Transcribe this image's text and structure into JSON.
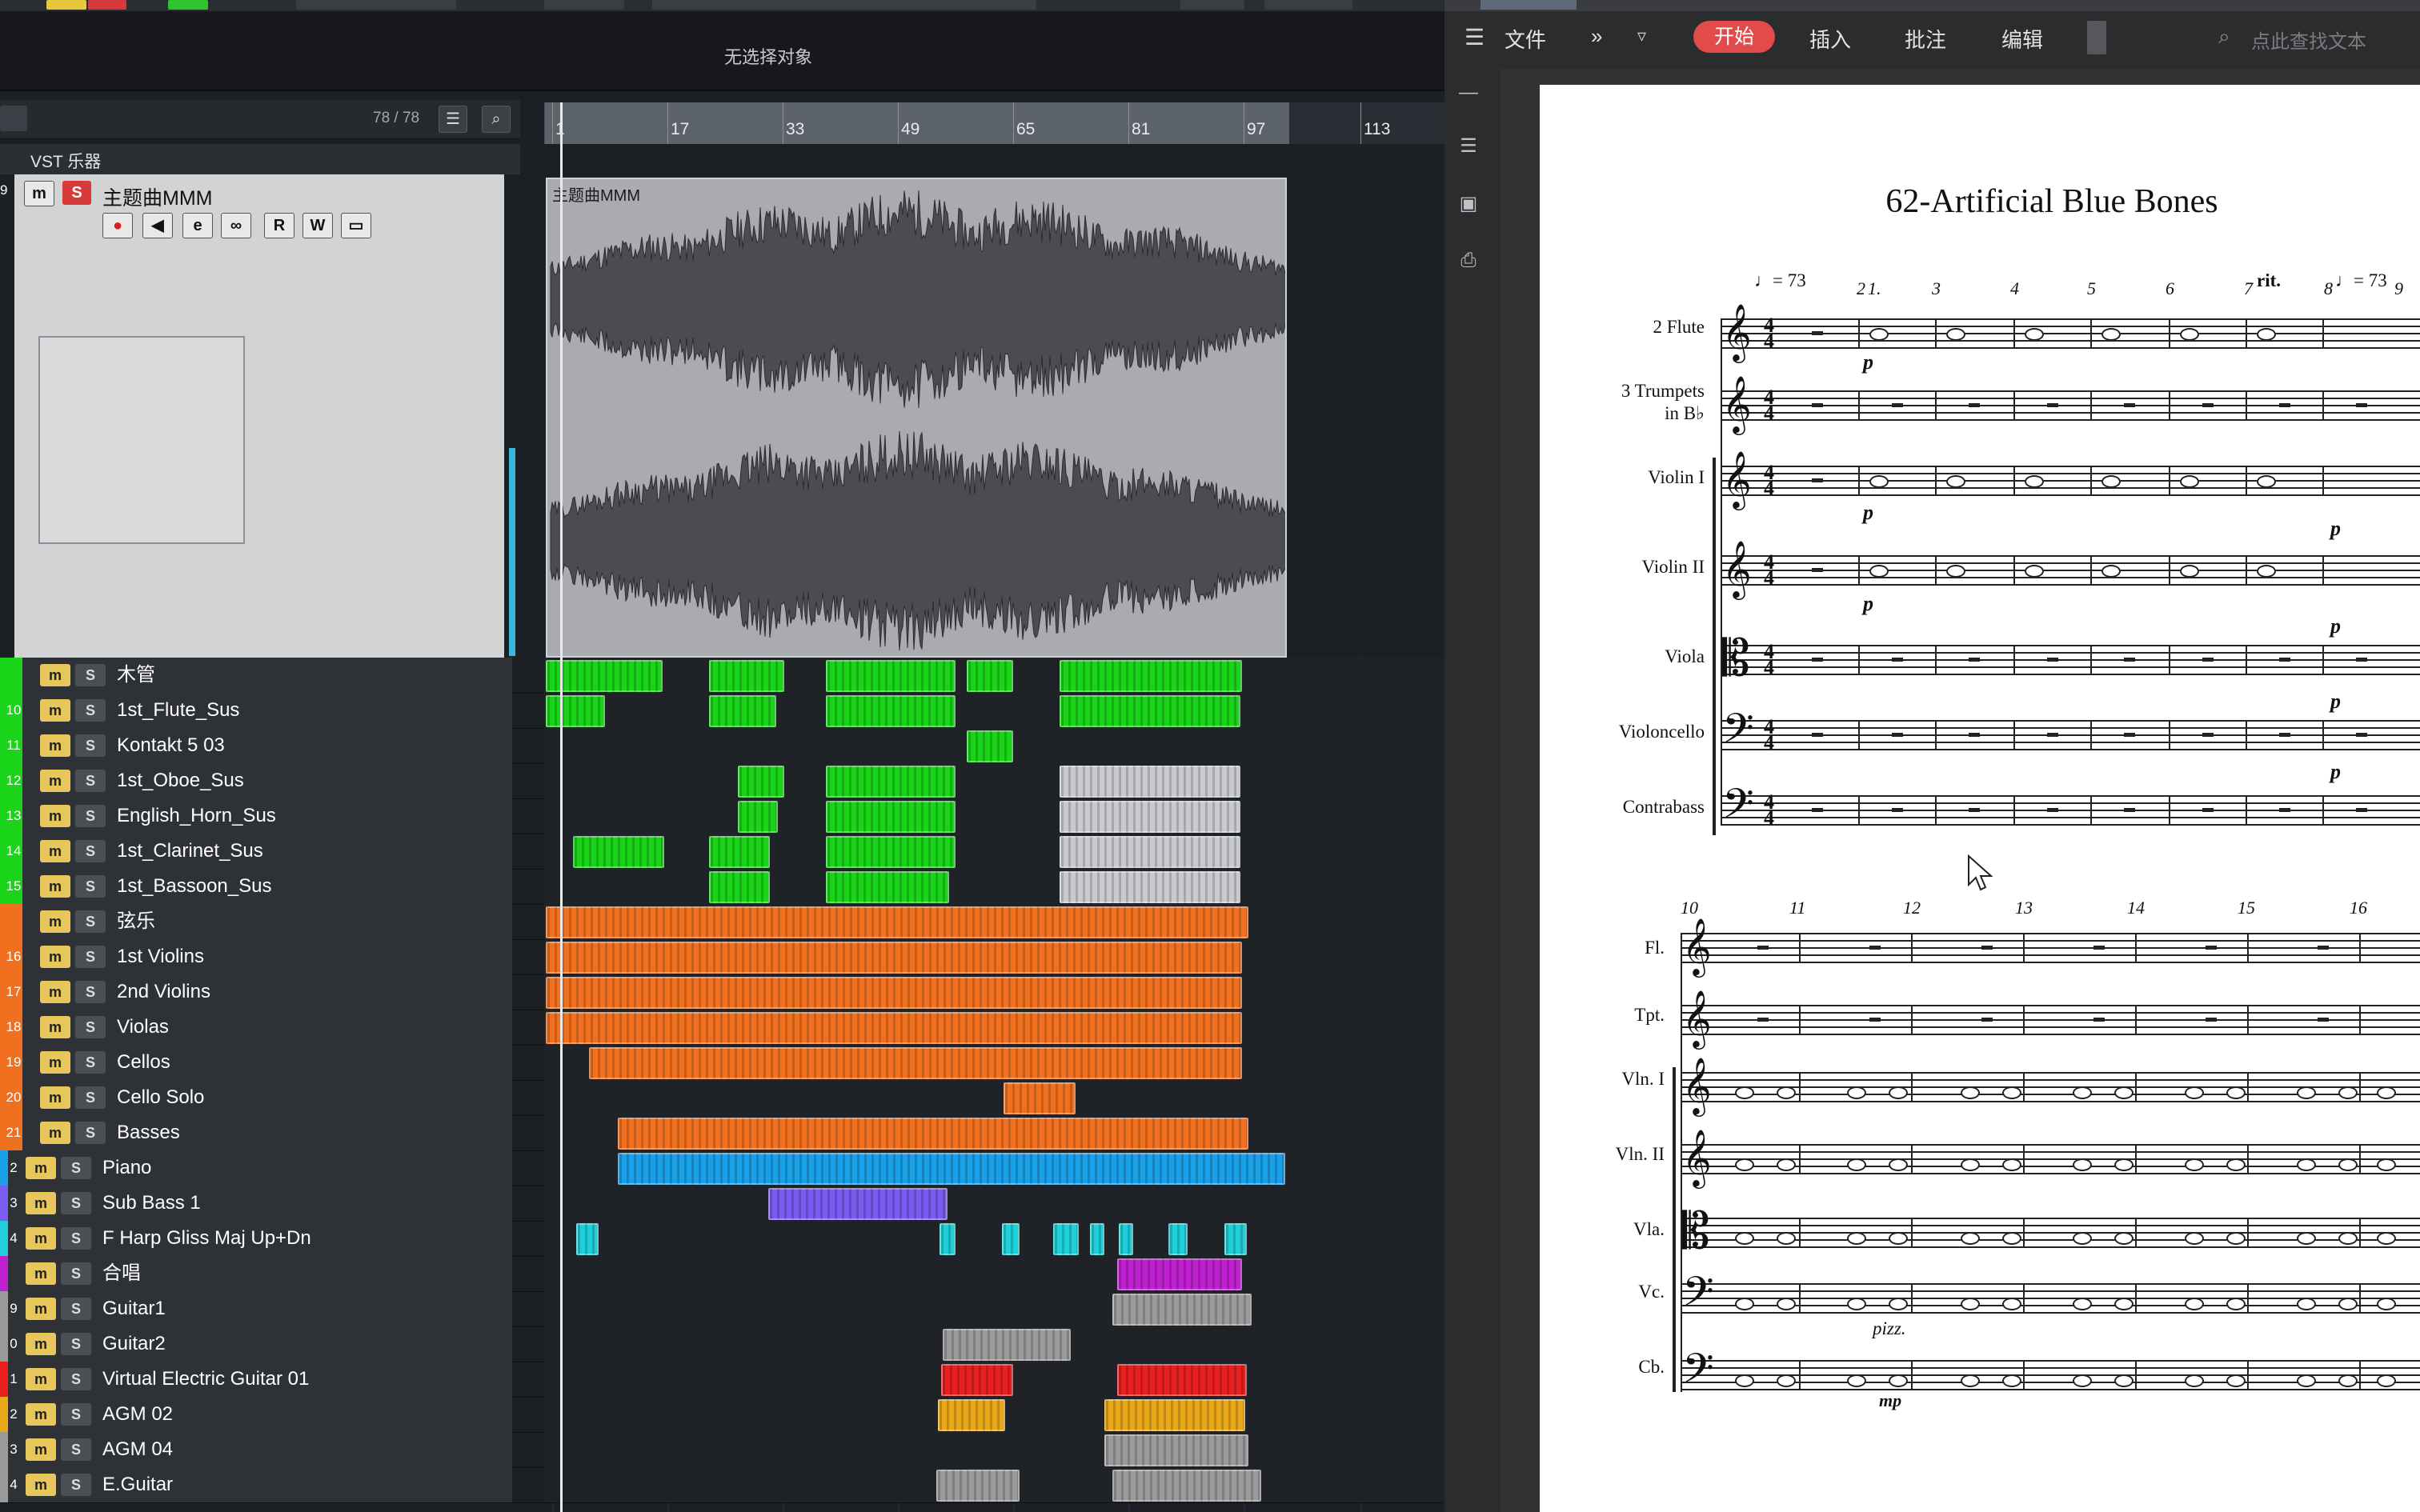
{
  "daw": {
    "selection_status": "无选择对象",
    "track_count": "78 / 78",
    "ruler_bars": [
      "1",
      "17",
      "33",
      "49",
      "65",
      "81",
      "97",
      "113"
    ],
    "folder_label": "VST 乐器",
    "main_track": {
      "number": "9",
      "name": "主题曲MMM",
      "event_label": "主题曲MMM",
      "buttons": [
        "m",
        "S",
        "●",
        "◀",
        "e",
        "∞",
        "R",
        "W",
        "▭"
      ]
    },
    "tracks": [
      {
        "num": "",
        "name": "木管",
        "color": "#19d419",
        "m": "m",
        "s": "S"
      },
      {
        "num": "10",
        "name": "1st_Flute_Sus",
        "color": "#19d419",
        "m": "m",
        "s": "S"
      },
      {
        "num": "11",
        "name": "Kontakt 5 03",
        "color": "#19d419",
        "m": "m",
        "s": "S"
      },
      {
        "num": "12",
        "name": "1st_Oboe_Sus",
        "color": "#19d419",
        "m": "m",
        "s": "S"
      },
      {
        "num": "13",
        "name": "English_Horn_Sus",
        "color": "#19d419",
        "m": "m",
        "s": "S"
      },
      {
        "num": "14",
        "name": "1st_Clarinet_Sus",
        "color": "#19d419",
        "m": "m",
        "s": "S"
      },
      {
        "num": "15",
        "name": "1st_Bassoon_Sus",
        "color": "#19d419",
        "m": "m",
        "s": "S"
      },
      {
        "num": "",
        "name": "弦乐",
        "color": "#f07020",
        "m": "m",
        "s": "S"
      },
      {
        "num": "16",
        "name": "1st Violins",
        "color": "#f07020",
        "m": "m",
        "s": "S"
      },
      {
        "num": "17",
        "name": "2nd Violins",
        "color": "#f07020",
        "m": "m",
        "s": "S"
      },
      {
        "num": "18",
        "name": "Violas",
        "color": "#f07020",
        "m": "m",
        "s": "S"
      },
      {
        "num": "19",
        "name": "Cellos",
        "color": "#f07020",
        "m": "m",
        "s": "S"
      },
      {
        "num": "20",
        "name": "Cello Solo",
        "color": "#f07020",
        "m": "m",
        "s": "S"
      },
      {
        "num": "21",
        "name": "Basses",
        "color": "#f07020",
        "m": "m",
        "s": "S"
      },
      {
        "num": "2",
        "name": "Piano",
        "color": "#1aa0e8",
        "m": "m",
        "s": "S"
      },
      {
        "num": "3",
        "name": "Sub Bass 1",
        "color": "#7a5cf0",
        "m": "m",
        "s": "S"
      },
      {
        "num": "4",
        "name": "F Harp Gliss Maj Up+Dn",
        "color": "#20d0d8",
        "m": "m",
        "s": "S"
      },
      {
        "num": "",
        "name": "合唱",
        "color": "#c020d0",
        "m": "m",
        "s": "S"
      },
      {
        "num": "9",
        "name": "Guitar1",
        "color": "#9a9a9a",
        "m": "m",
        "s": "S"
      },
      {
        "num": "0",
        "name": "Guitar2",
        "color": "#9a9a9a",
        "m": "m",
        "s": "S"
      },
      {
        "num": "1",
        "name": "Virtual Electric Guitar 01",
        "color": "#e82020",
        "m": "m",
        "s": "S"
      },
      {
        "num": "2",
        "name": "AGM 02",
        "color": "#e8a818",
        "m": "m",
        "s": "S"
      },
      {
        "num": "3",
        "name": "AGM 04",
        "color": "#9a9a9a",
        "m": "m",
        "s": "S"
      },
      {
        "num": "4",
        "name": "E.Guitar",
        "color": "#9a9a9a",
        "m": "m",
        "s": "S"
      }
    ]
  },
  "wps": {
    "menu": {
      "file": "文件",
      "more": "»",
      "start": "开始",
      "insert": "插入",
      "review": "批注",
      "edit": "编辑"
    },
    "search_placeholder": "点此查找文本",
    "score": {
      "title": "62-Artificial Blue Bones",
      "tempo_1": "♩= 73",
      "tempo_2": "♩= 73",
      "rit": "rit.",
      "system1_measures": [
        "2",
        "1.",
        "3",
        "4",
        "5",
        "6",
        "7",
        "8",
        "9"
      ],
      "system1_instruments": [
        "2 Flute",
        "3 Trumpets",
        "in B♭",
        "Violin I",
        "Violin II",
        "Viola",
        "Violoncello",
        "Contrabass"
      ],
      "system2_measures": [
        "10",
        "11",
        "12",
        "13",
        "14",
        "15",
        "16"
      ],
      "system2_instruments": [
        "Fl.",
        "Tpt.",
        "Vln. I",
        "Vln. II",
        "Vla.",
        "Vc.",
        "Cb."
      ],
      "dynamic_p": "p",
      "dynamic_mp": "mp",
      "pizz": "pizz."
    }
  }
}
